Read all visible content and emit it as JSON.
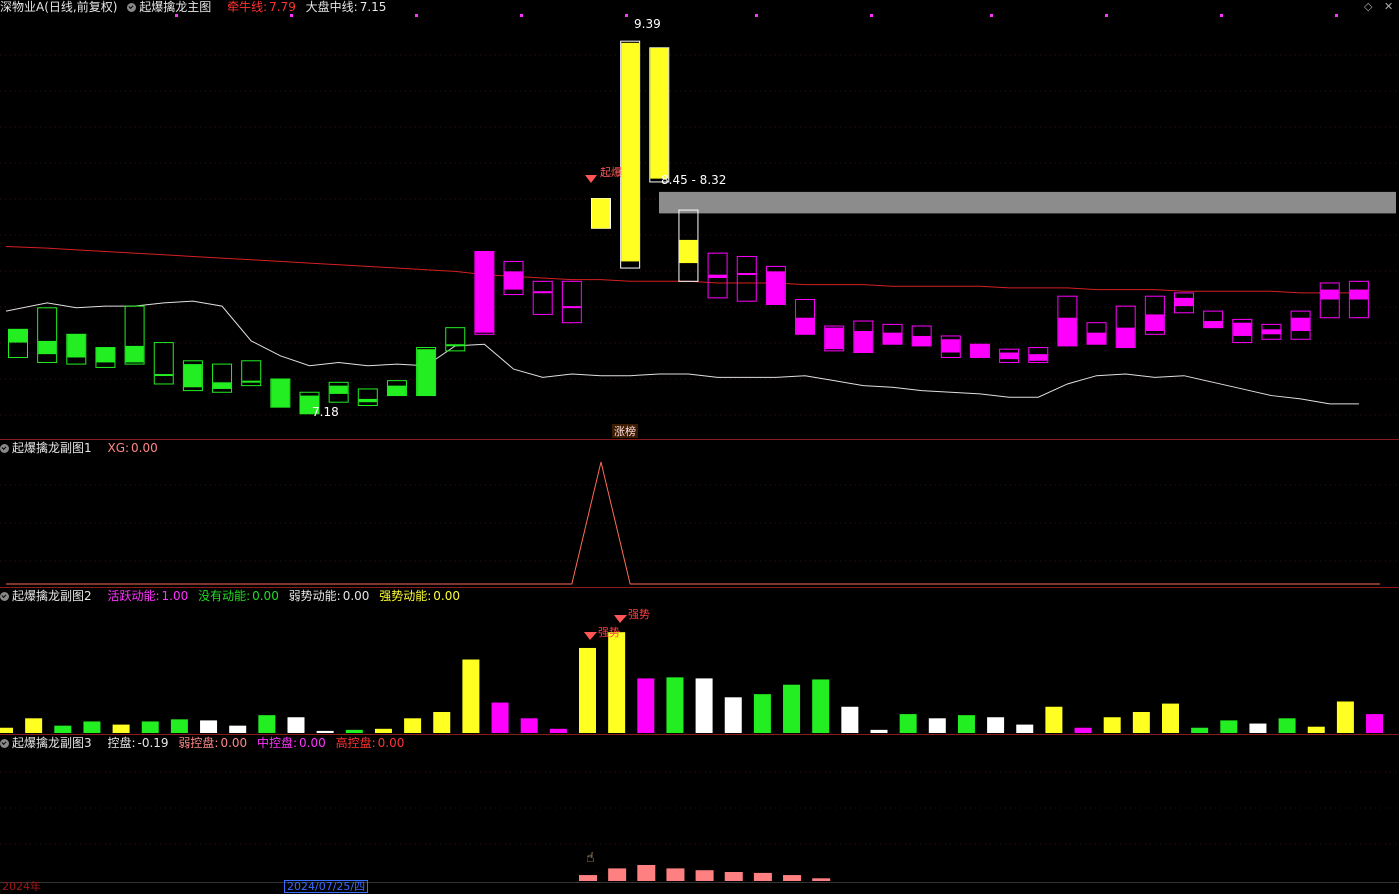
{
  "main_header": {
    "stock": "深物业A(日线,前复权)",
    "indicator": "起爆擒龙主图",
    "line1_label": "牵牛线:",
    "line1_value": "7.79",
    "line2_label": "大盘中线:",
    "line2_value": "7.15"
  },
  "annotations": {
    "high_price": "9.39",
    "low_price": "7.18",
    "zone": "8.45 - 8.32",
    "signal_qibao": "起爆",
    "limit_up": "涨榜",
    "strong1": "强势",
    "strong2": "强势"
  },
  "sub1_header": {
    "name": "起爆擒龙副图1",
    "xg_label": "XG:",
    "xg_value": "0.00"
  },
  "sub2_header": {
    "name": "起爆擒龙副图2",
    "a_label": "活跃动能:",
    "a_value": "1.00",
    "b_label": "没有动能:",
    "b_value": "0.00",
    "c_label": "弱势动能:",
    "c_value": "0.00",
    "d_label": "强势动能:",
    "d_value": "0.00"
  },
  "sub3_header": {
    "name": "起爆擒龙副图3",
    "a_label": "控盘:",
    "a_value": "-0.19",
    "b_label": "弱控盘:",
    "b_value": "0.00",
    "c_label": "中控盘:",
    "c_value": "0.00",
    "d_label": "高控盘:",
    "d_value": "0.00"
  },
  "footer": {
    "year": "2024年",
    "date": "2024/07/25/四"
  },
  "colors": {
    "up": "#ff00ff",
    "down": "#22ee22",
    "surge": "#ffff22",
    "neutral": "#ffffff",
    "red_line": "#d42020",
    "control": "#ff8080"
  },
  "chart_data": {
    "type": "candlestick",
    "price_range": [
      7.0,
      9.5
    ],
    "candles": [
      {
        "o": 7.62,
        "c": 7.54,
        "h": 7.62,
        "l": 7.45,
        "col": "down"
      },
      {
        "o": 7.55,
        "c": 7.47,
        "h": 7.75,
        "l": 7.42,
        "col": "down"
      },
      {
        "o": 7.59,
        "c": 7.45,
        "h": 7.59,
        "l": 7.41,
        "col": "down"
      },
      {
        "o": 7.51,
        "c": 7.42,
        "h": 7.51,
        "l": 7.39,
        "col": "down"
      },
      {
        "o": 7.52,
        "c": 7.42,
        "h": 7.76,
        "l": 7.41,
        "col": "down"
      },
      {
        "o": 7.35,
        "c": 7.35,
        "h": 7.54,
        "l": 7.29,
        "col": "down"
      },
      {
        "o": 7.41,
        "c": 7.27,
        "h": 7.43,
        "l": 7.25,
        "col": "down"
      },
      {
        "o": 7.3,
        "c": 7.26,
        "h": 7.41,
        "l": 7.24,
        "col": "down"
      },
      {
        "o": 7.31,
        "c": 7.31,
        "h": 7.43,
        "l": 7.28,
        "col": "down"
      },
      {
        "o": 7.32,
        "c": 7.15,
        "h": 7.32,
        "l": 7.15,
        "col": "down"
      },
      {
        "o": 7.22,
        "c": 7.11,
        "h": 7.24,
        "l": 7.11,
        "col": "down"
      },
      {
        "o": 7.23,
        "c": 7.28,
        "h": 7.3,
        "l": 7.18,
        "col": "down"
      },
      {
        "o": 7.2,
        "c": 7.18,
        "h": 7.26,
        "l": 7.16,
        "col": "down"
      },
      {
        "o": 7.22,
        "c": 7.28,
        "h": 7.31,
        "l": 7.22,
        "col": "down"
      },
      {
        "o": 7.22,
        "c": 7.5,
        "h": 7.51,
        "l": 7.22,
        "col": "down"
      },
      {
        "o": 7.53,
        "c": 7.53,
        "h": 7.63,
        "l": 7.49,
        "col": "down"
      },
      {
        "o": 7.6,
        "c": 8.09,
        "h": 8.09,
        "l": 7.59,
        "col": "up"
      },
      {
        "o": 7.86,
        "c": 7.97,
        "h": 8.03,
        "l": 7.83,
        "col": "up"
      },
      {
        "o": 7.85,
        "c": 7.85,
        "h": 7.91,
        "l": 7.71,
        "col": "up"
      },
      {
        "o": 7.76,
        "c": 7.76,
        "h": 7.91,
        "l": 7.66,
        "col": "up"
      },
      {
        "o": 8.23,
        "c": 8.41,
        "h": 8.41,
        "l": 8.23,
        "col": "surge"
      },
      {
        "o": 8.03,
        "c": 9.35,
        "h": 9.36,
        "l": 7.99,
        "col": "surge"
      },
      {
        "o": 8.53,
        "c": 9.32,
        "h": 9.32,
        "l": 8.51,
        "col": "surge"
      },
      {
        "o": 8.02,
        "c": 8.16,
        "h": 8.34,
        "l": 7.91,
        "col": "surge"
      },
      {
        "o": 7.93,
        "c": 7.95,
        "h": 8.08,
        "l": 7.81,
        "col": "up"
      },
      {
        "o": 7.96,
        "c": 7.96,
        "h": 8.06,
        "l": 7.79,
        "col": "up"
      },
      {
        "o": 7.77,
        "c": 7.97,
        "h": 8.0,
        "l": 7.77,
        "col": "up"
      },
      {
        "o": 7.59,
        "c": 7.69,
        "h": 7.8,
        "l": 7.59,
        "col": "up"
      },
      {
        "o": 7.5,
        "c": 7.63,
        "h": 7.64,
        "l": 7.49,
        "col": "up"
      },
      {
        "o": 7.48,
        "c": 7.61,
        "h": 7.67,
        "l": 7.48,
        "col": "up"
      },
      {
        "o": 7.53,
        "c": 7.6,
        "h": 7.65,
        "l": 7.53,
        "col": "up"
      },
      {
        "o": 7.52,
        "c": 7.58,
        "h": 7.64,
        "l": 7.52,
        "col": "up"
      },
      {
        "o": 7.48,
        "c": 7.56,
        "h": 7.58,
        "l": 7.45,
        "col": "up"
      },
      {
        "o": 7.45,
        "c": 7.53,
        "h": 7.53,
        "l": 7.45,
        "col": "up"
      },
      {
        "o": 7.44,
        "c": 7.48,
        "h": 7.5,
        "l": 7.42,
        "col": "up"
      },
      {
        "o": 7.43,
        "c": 7.47,
        "h": 7.51,
        "l": 7.42,
        "col": "up"
      },
      {
        "o": 7.52,
        "c": 7.69,
        "h": 7.82,
        "l": 7.52,
        "col": "up"
      },
      {
        "o": 7.53,
        "c": 7.6,
        "h": 7.66,
        "l": 7.53,
        "col": "up"
      },
      {
        "o": 7.51,
        "c": 7.63,
        "h": 7.76,
        "l": 7.51,
        "col": "up"
      },
      {
        "o": 7.61,
        "c": 7.71,
        "h": 7.82,
        "l": 7.59,
        "col": "up"
      },
      {
        "o": 7.76,
        "c": 7.81,
        "h": 7.84,
        "l": 7.72,
        "col": "up"
      },
      {
        "o": 7.63,
        "c": 7.67,
        "h": 7.73,
        "l": 7.63,
        "col": "up"
      },
      {
        "o": 7.58,
        "c": 7.66,
        "h": 7.68,
        "l": 7.54,
        "col": "up"
      },
      {
        "o": 7.59,
        "c": 7.62,
        "h": 7.65,
        "l": 7.56,
        "col": "up"
      },
      {
        "o": 7.61,
        "c": 7.69,
        "h": 7.73,
        "l": 7.56,
        "col": "up"
      },
      {
        "o": 7.8,
        "c": 7.86,
        "h": 7.9,
        "l": 7.69,
        "col": "up"
      },
      {
        "o": 7.8,
        "c": 7.86,
        "h": 7.91,
        "l": 7.69,
        "col": "up"
      }
    ],
    "red_line": [
      8.12,
      8.11,
      8.1,
      8.09,
      8.08,
      8.07,
      8.06,
      8.05,
      8.04,
      8.03,
      8.02,
      8.01,
      8.0,
      7.99,
      7.98,
      7.97,
      7.95,
      7.94,
      7.93,
      7.92,
      7.92,
      7.91,
      7.91,
      7.91,
      7.9,
      7.9,
      7.9,
      7.89,
      7.89,
      7.89,
      7.88,
      7.88,
      7.88,
      7.88,
      7.87,
      7.87,
      7.87,
      7.86,
      7.86,
      7.86,
      7.85,
      7.85,
      7.85,
      7.85,
      7.84,
      7.84,
      7.84
    ],
    "white_line": [
      7.73,
      7.78,
      7.75,
      7.76,
      7.76,
      7.78,
      7.79,
      7.76,
      7.55,
      7.46,
      7.4,
      7.42,
      7.4,
      7.41,
      7.4,
      7.52,
      7.53,
      7.38,
      7.33,
      7.35,
      7.34,
      7.34,
      7.35,
      7.35,
      7.33,
      7.33,
      7.33,
      7.34,
      7.31,
      7.28,
      7.27,
      7.25,
      7.24,
      7.23,
      7.21,
      7.21,
      7.29,
      7.34,
      7.35,
      7.33,
      7.34,
      7.3,
      7.26,
      7.22,
      7.2,
      7.17,
      7.17
    ],
    "sub1_xg": [
      0,
      0,
      0,
      0,
      0,
      0,
      0,
      0,
      0,
      0,
      0,
      0,
      0,
      0,
      0,
      0,
      0,
      0,
      0,
      0,
      1,
      0,
      0,
      0,
      0,
      0,
      0,
      0,
      0,
      0,
      0,
      0,
      0,
      0,
      0,
      0,
      0,
      0,
      0,
      0,
      0,
      0,
      0,
      0,
      0,
      0,
      0
    ],
    "sub2_bars": [
      {
        "v": 0.05,
        "col": "surge"
      },
      {
        "v": 0.14,
        "col": "surge"
      },
      {
        "v": 0.07,
        "col": "down"
      },
      {
        "v": 0.11,
        "col": "down"
      },
      {
        "v": 0.08,
        "col": "surge"
      },
      {
        "v": 0.11,
        "col": "down"
      },
      {
        "v": 0.13,
        "col": "down"
      },
      {
        "v": 0.12,
        "col": "neutral"
      },
      {
        "v": 0.07,
        "col": "neutral"
      },
      {
        "v": 0.17,
        "col": "down"
      },
      {
        "v": 0.15,
        "col": "neutral"
      },
      {
        "v": 0.02,
        "col": "neutral"
      },
      {
        "v": 0.03,
        "col": "down"
      },
      {
        "v": 0.04,
        "col": "surge"
      },
      {
        "v": 0.14,
        "col": "surge"
      },
      {
        "v": 0.2,
        "col": "surge"
      },
      {
        "v": 0.7,
        "col": "surge"
      },
      {
        "v": 0.29,
        "col": "up"
      },
      {
        "v": 0.14,
        "col": "up"
      },
      {
        "v": 0.04,
        "col": "up"
      },
      {
        "v": 0.81,
        "col": "surge"
      },
      {
        "v": 0.96,
        "col": "surge"
      },
      {
        "v": 0.52,
        "col": "up"
      },
      {
        "v": 0.53,
        "col": "down"
      },
      {
        "v": 0.52,
        "col": "neutral"
      },
      {
        "v": 0.34,
        "col": "neutral"
      },
      {
        "v": 0.37,
        "col": "down"
      },
      {
        "v": 0.46,
        "col": "down"
      },
      {
        "v": 0.51,
        "col": "down"
      },
      {
        "v": 0.25,
        "col": "neutral"
      },
      {
        "v": 0.03,
        "col": "neutral"
      },
      {
        "v": 0.18,
        "col": "down"
      },
      {
        "v": 0.14,
        "col": "neutral"
      },
      {
        "v": 0.17,
        "col": "down"
      },
      {
        "v": 0.15,
        "col": "neutral"
      },
      {
        "v": 0.08,
        "col": "neutral"
      },
      {
        "v": 0.25,
        "col": "surge"
      },
      {
        "v": 0.05,
        "col": "up"
      },
      {
        "v": 0.15,
        "col": "surge"
      },
      {
        "v": 0.2,
        "col": "surge"
      },
      {
        "v": 0.28,
        "col": "surge"
      },
      {
        "v": 0.05,
        "col": "down"
      },
      {
        "v": 0.12,
        "col": "down"
      },
      {
        "v": 0.09,
        "col": "neutral"
      },
      {
        "v": 0.14,
        "col": "down"
      },
      {
        "v": 0.06,
        "col": "surge"
      },
      {
        "v": 0.3,
        "col": "surge"
      },
      {
        "v": 0.18,
        "col": "up"
      }
    ],
    "sub3_bars": [
      0,
      0,
      0,
      0,
      0,
      0,
      0,
      0,
      0,
      0,
      0,
      0,
      0,
      0,
      0,
      0,
      0,
      0,
      0,
      0,
      0.33,
      0.7,
      0.89,
      0.7,
      0.6,
      0.5,
      0.45,
      0.33,
      0.15,
      0,
      0,
      0,
      0,
      0,
      0,
      0,
      0,
      0,
      0,
      0,
      0,
      0,
      0,
      0,
      0,
      0,
      0
    ]
  }
}
